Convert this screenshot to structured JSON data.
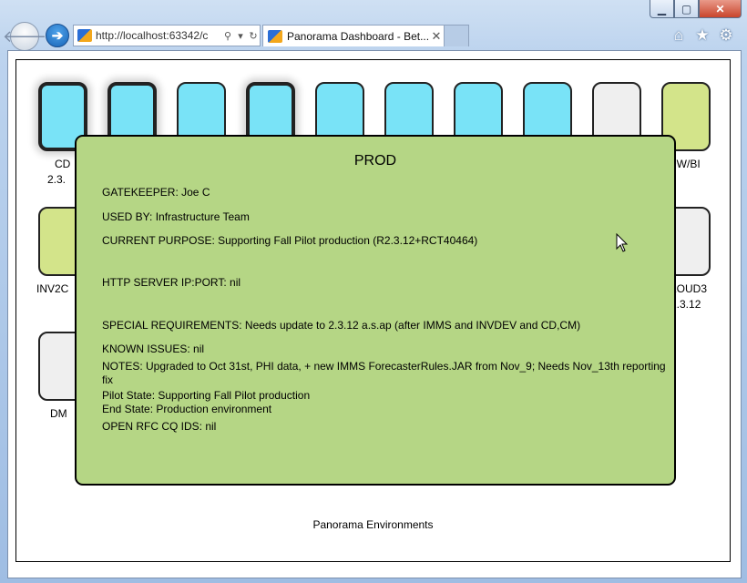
{
  "browser": {
    "address_url": "http://localhost:63342/c",
    "tab_title": "Panorama Dashboard - Bet..."
  },
  "dashboard": {
    "row1_label_left_line1": "CD",
    "row1_label_left_line2": "2.3.",
    "row1_label_right": "DW/BI",
    "row2_label_left": "INV2C",
    "row2_label_right_line1": "LOUD3",
    "row2_label_right_line2": "2.3.12",
    "row3_label_left": "DM",
    "footer": "Panorama Environments"
  },
  "popup": {
    "title": "PROD",
    "gatekeeper": "GATEKEEPER: Joe C",
    "used_by": "USED BY: Infrastructure Team",
    "current_purpose": "CURRENT PURPOSE: Supporting Fall Pilot production (R2.3.12+RCT40464)",
    "http_server": "HTTP SERVER IP:PORT: nil",
    "special_requirements": "SPECIAL REQUIREMENTS: Needs update to 2.3.12 a.s.ap (after IMMS and INVDEV and CD,CM)",
    "known_issues": "KNOWN ISSUES: nil",
    "notes": "NOTES: Upgraded to Oct 31st, PHI data, + new IMMS ForecasterRules.JAR from Nov_9; Needs Nov_13th reporting fix",
    "pilot_state": "Pilot State: Supporting Fall Pilot production",
    "end_state": "End State: Production environment",
    "open_rfc": "OPEN RFC CQ IDS: nil"
  },
  "colors": {
    "cyan_box": "#79e3f7",
    "grey_box": "#efefef",
    "lime_box": "#d3e48a",
    "popup_bg": "#b5d685"
  }
}
